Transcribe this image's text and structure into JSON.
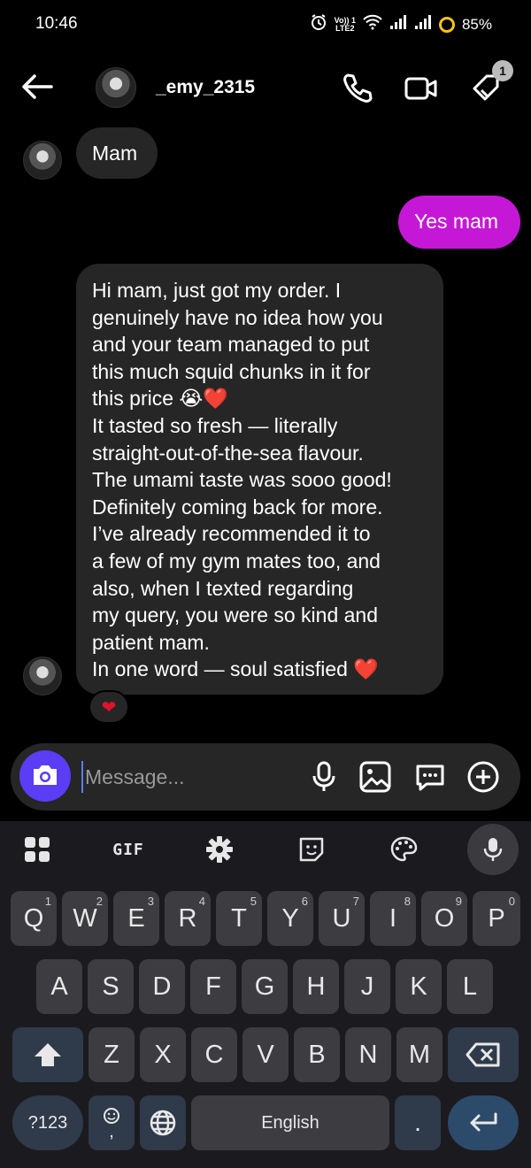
{
  "status_bar": {
    "time": "10:46",
    "volte_line1": "Vo)) 1",
    "volte_line2": "LTE2",
    "battery": "85%"
  },
  "header": {
    "username": "_emy_2315",
    "notification_badge": "1"
  },
  "messages": [
    {
      "sender": "them",
      "text": "Mam"
    },
    {
      "sender": "me",
      "text": "Yes mam"
    },
    {
      "sender": "them",
      "text": "Hi mam, just got my order. I\ngenuinely have no idea how you\nand your team managed to put\nthis much squid chunks in it for\nthis price 😭❤️\nIt tasted so fresh — literally\nstraight-out-of-the-sea flavour.\nThe umami taste was sooo good!\nDefinitely coming back for more.\nI’ve already recommended it to\na few of my gym mates too, and\nalso, when I texted regarding\nmy query, you were so kind and\npatient mam.\nIn one word — soul satisfied ❤️"
    }
  ],
  "reaction": "❤",
  "composer": {
    "placeholder": "Message..."
  },
  "keyboard": {
    "toolbar_gif": "GIF",
    "row1": [
      {
        "key": "Q",
        "alt": "1"
      },
      {
        "key": "W",
        "alt": "2"
      },
      {
        "key": "E",
        "alt": "3"
      },
      {
        "key": "R",
        "alt": "4"
      },
      {
        "key": "T",
        "alt": "5"
      },
      {
        "key": "Y",
        "alt": "6"
      },
      {
        "key": "U",
        "alt": "7"
      },
      {
        "key": "I",
        "alt": "8"
      },
      {
        "key": "O",
        "alt": "9"
      },
      {
        "key": "P",
        "alt": "0"
      }
    ],
    "row2": [
      "A",
      "S",
      "D",
      "F",
      "G",
      "H",
      "J",
      "K",
      "L"
    ],
    "row3": [
      "Z",
      "X",
      "C",
      "V",
      "B",
      "N",
      "M"
    ],
    "symbols_key": "?123",
    "comma_key": ",",
    "space_label": "English",
    "period_key": "."
  },
  "colors": {
    "outgoing_bubble": "#c517d6",
    "incoming_bubble": "#262626",
    "camera_button": "#5a3df5"
  }
}
